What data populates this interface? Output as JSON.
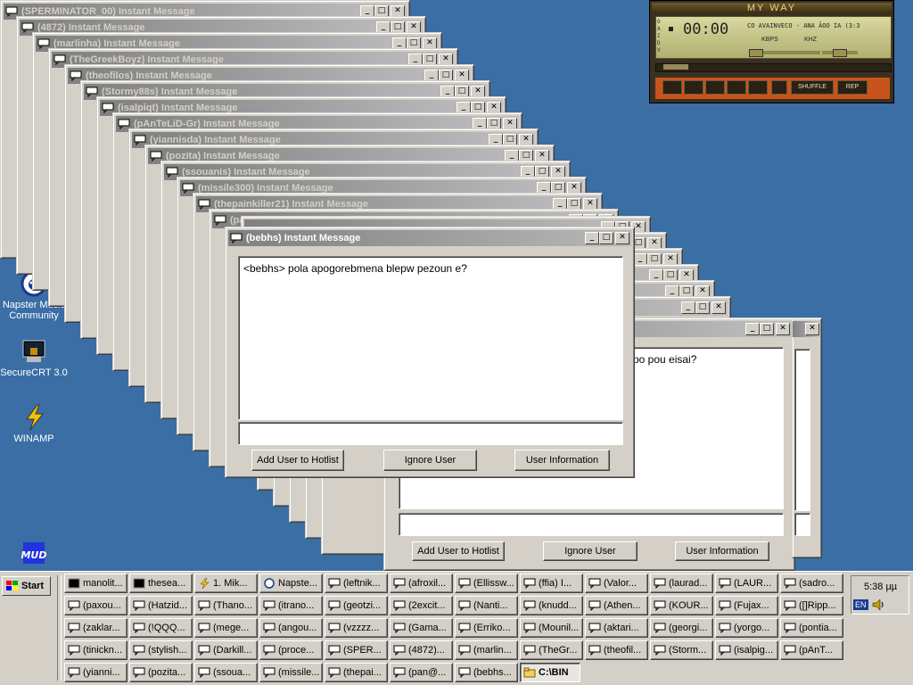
{
  "stack_windows": [
    {
      "title": "(SPERMINATOR_00) Instant Message"
    },
    {
      "title": "(4872) Instant Message"
    },
    {
      "title": "(marlinha) Instant Message"
    },
    {
      "title": "(TheGreekBoyz) Instant Message"
    },
    {
      "title": "(theofilos) Instant Message"
    },
    {
      "title": "(Stormy88s) Instant Message"
    },
    {
      "title": "(isalpiqt) Instant Message"
    },
    {
      "title": "(pAnTeLiD-Gr) Instant Message"
    },
    {
      "title": "(yiannisda) Instant Message"
    },
    {
      "title": "(pozita) Instant Message"
    },
    {
      "title": "(ssouanis) Instant Message"
    },
    {
      "title": "(missile300) Instant Message"
    },
    {
      "title": "(thepainkiller21) Instant Message"
    },
    {
      "title": "(pan@s) Instant Message"
    }
  ],
  "active_window": {
    "title": "(bebhs) Instant Message",
    "message": "<bebhs> pola apogorebmena blepw pezoun e?",
    "btn_add": "Add User to Hotlist",
    "btn_ignore": "Ignore User",
    "btn_info": "User Information"
  },
  "back_window": {
    "message_fragment": "po pou eisai?",
    "btn_add": "Add User to Hotlist",
    "btn_ignore": "Ignore User",
    "btn_info": "User Information"
  },
  "window_buttons": {
    "minimize": "_",
    "maximize": "□",
    "close": "✕"
  },
  "desktop_icons": [
    {
      "label": "Napster Music Community",
      "icon": "napster-icon"
    },
    {
      "label": "SecureCRT 3.0",
      "icon": "securecrt-icon"
    },
    {
      "label": "WINAMP",
      "icon": "winamp-icon"
    },
    {
      "label": "MUD",
      "icon": "mud-icon"
    }
  ],
  "winamp": {
    "title": "MY WAY",
    "time": "00:00",
    "track": "CO  AVAINVECO - ANA ÃOO IA (3:3",
    "kbps_label": "KBPS",
    "khz_label": "KHZ",
    "shuffle": "SHUFFLE",
    "rep": "REP",
    "side_letters": "OAIDV"
  },
  "taskbar": {
    "start_label": "Start",
    "rows": [
      [
        "manolit...",
        "thesea...",
        "1. Mik...",
        "Napste...",
        "(leftnik...",
        "(afroxil...",
        "(Ellissw...",
        "(ffia) I...",
        "(Valor...",
        "(laurad...",
        "(LAUR...",
        "(sadro..."
      ],
      [
        "(paxou...",
        "(Hatzid...",
        "(Thano...",
        "(itrano...",
        "(geotzi...",
        "(2excit...",
        "(Nanti...",
        "(knudd...",
        "(Athen...",
        "(KOUR...",
        "(Fujax...",
        "([]Ripp..."
      ],
      [
        "(zaklar...",
        "(!QQQ...",
        "(mege...",
        "(angou...",
        "(vzzzz...",
        "(Gama...",
        "(Erriko...",
        "(Mounil...",
        "(aktari...",
        "(georgi...",
        "(yorgo...",
        "(pontia..."
      ],
      [
        "(tinickn...",
        "(stylish...",
        "(Darkill...",
        "(proce...",
        "(SPER...",
        "(4872)...",
        "(marlin...",
        "(TheGr...",
        "(theofil...",
        "(Storm...",
        "(isalpig...",
        "(pAnT..."
      ],
      [
        "(yianni...",
        "(pozita...",
        "(ssoua...",
        "(missile...",
        "(thepai...",
        "(pan@...",
        "(bebhs...",
        "C:\\BIN"
      ]
    ],
    "clock": "5:38 µµ",
    "lang": "EN"
  }
}
